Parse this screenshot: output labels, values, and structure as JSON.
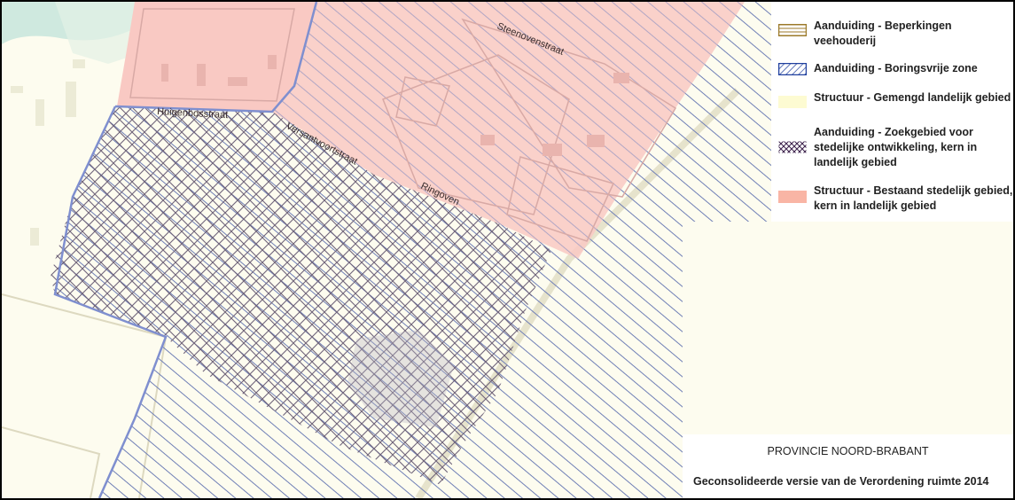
{
  "map": {
    "streets": [
      "Huigenbosstraat",
      "Versantvoortstraat",
      "Ringoven",
      "Steenovenstraat"
    ],
    "colors": {
      "background": "#fdfcef",
      "urban_fill": "#f9c9c3",
      "drilling_hatch": "#6f7fb6",
      "search_area_hatch": "#6f6379",
      "livestock_border": "#9c7a2a",
      "water": "#cfe9df"
    }
  },
  "legend": {
    "items": [
      {
        "label": "Aanduiding - Beperkingen veehouderij",
        "symbol": "horizontal-lines-brown"
      },
      {
        "label": "Aanduiding - Boringsvrije zone",
        "symbol": "diagonal-hatch-blue"
      },
      {
        "label": "Structuur - Gemengd landelijk gebied",
        "symbol": "solid-light-yellow"
      },
      {
        "label": "Aanduiding - Zoekgebied voor stedelijke ontwikkeling, kern in landelijk gebied",
        "symbol": "cross-hatch-purple"
      },
      {
        "label": "Structuur - Bestaand stedelijk gebied, kern in landelijk gebied",
        "symbol": "solid-salmon"
      }
    ]
  },
  "caption": {
    "province": "PROVINCIE NOORD-BRABANT",
    "subtitle": "Geconsolideerde versie van de Verordening ruimte 2014"
  }
}
